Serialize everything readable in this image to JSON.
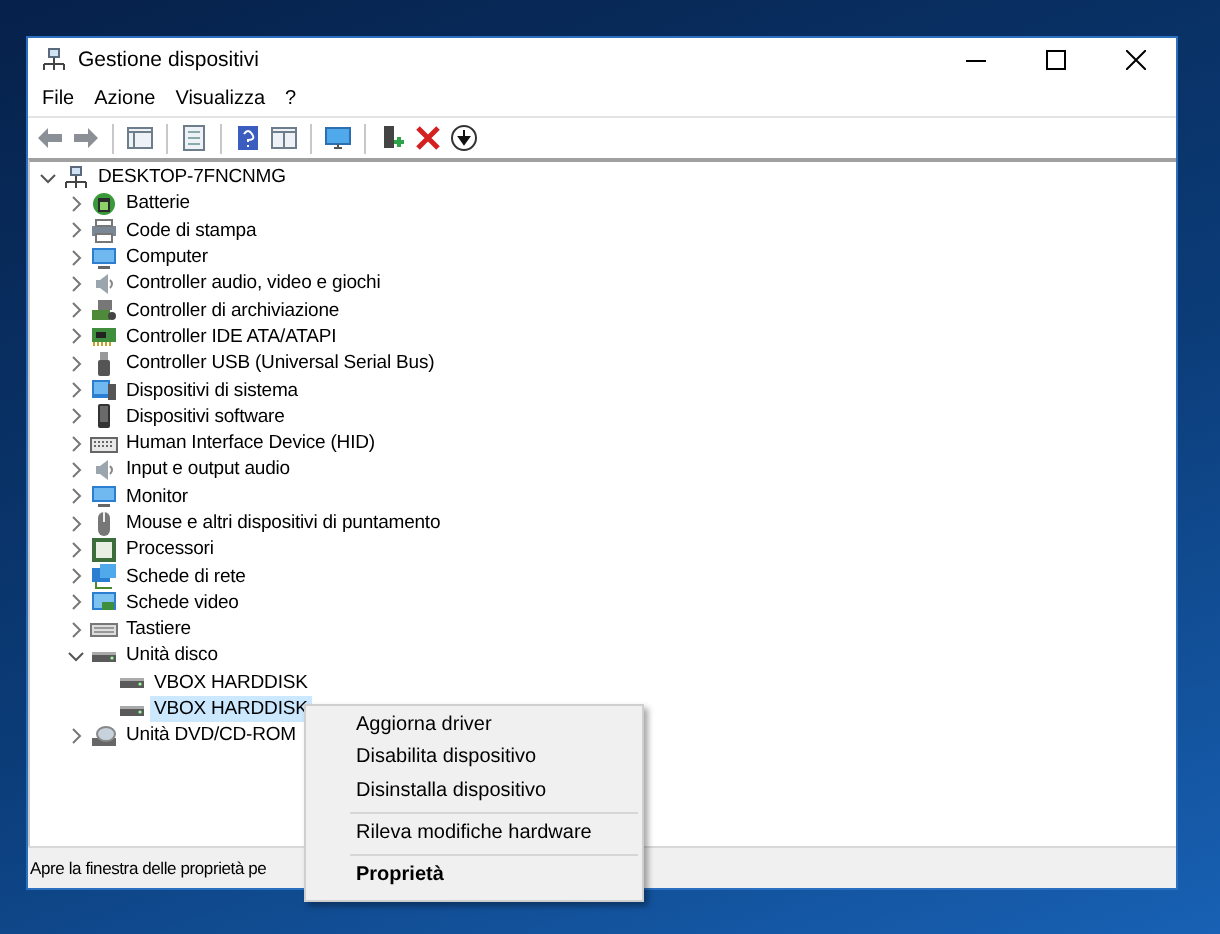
{
  "window": {
    "title": "Gestione dispositivi"
  },
  "menu": [
    "File",
    "Azione",
    "Visualizza",
    "?"
  ],
  "tree": [
    {
      "label": "DESKTOP-7FNCNMG",
      "expanded": true,
      "selected": false,
      "children": [
        {
          "label": "Batterie",
          "expanded": false,
          "selected": false
        },
        {
          "label": "Code di stampa",
          "expanded": false,
          "selected": false
        },
        {
          "label": "Computer",
          "expanded": false,
          "selected": false
        },
        {
          "label": "Controller audio, video e giochi",
          "expanded": false,
          "selected": false
        },
        {
          "label": "Controller di archiviazione",
          "expanded": false,
          "selected": false
        },
        {
          "label": "Controller IDE ATA/ATAPI",
          "expanded": false,
          "selected": false
        },
        {
          "label": "Controller USB (Universal Serial Bus)",
          "expanded": false,
          "selected": false
        },
        {
          "label": "Dispositivi di sistema",
          "expanded": false,
          "selected": false
        },
        {
          "label": "Dispositivi software",
          "expanded": false,
          "selected": false
        },
        {
          "label": "Human Interface Device (HID)",
          "expanded": false,
          "selected": false
        },
        {
          "label": "Input e output audio",
          "expanded": false,
          "selected": false
        },
        {
          "label": "Monitor",
          "expanded": false,
          "selected": false
        },
        {
          "label": "Mouse e altri dispositivi di puntamento",
          "expanded": false,
          "selected": false
        },
        {
          "label": "Processori",
          "expanded": false,
          "selected": false
        },
        {
          "label": "Schede di rete",
          "expanded": false,
          "selected": false
        },
        {
          "label": "Schede video",
          "expanded": false,
          "selected": false
        },
        {
          "label": "Tastiere",
          "expanded": false,
          "selected": false
        },
        {
          "label": "Unità disco",
          "expanded": true,
          "selected": false,
          "children": [
            {
              "label": "VBOX HARDDISK",
              "selected": false
            },
            {
              "label": "VBOX HARDDISK",
              "selected": true
            }
          ]
        },
        {
          "label": "Unità DVD/CD-ROM",
          "expanded": false,
          "selected": false
        }
      ]
    }
  ],
  "status_bar": "Apre la finestra delle proprietà pe",
  "context_menu": [
    {
      "kind": "item",
      "label": "Aggiorna driver",
      "default": false
    },
    {
      "kind": "item",
      "label": "Disabilita dispositivo",
      "default": false
    },
    {
      "kind": "item",
      "label": "Disinstalla dispositivo",
      "default": false
    },
    {
      "kind": "separator"
    },
    {
      "kind": "item",
      "label": "Rileva modifiche hardware",
      "default": false
    },
    {
      "kind": "separator"
    },
    {
      "kind": "item",
      "label": "Proprietà",
      "default": true
    }
  ]
}
